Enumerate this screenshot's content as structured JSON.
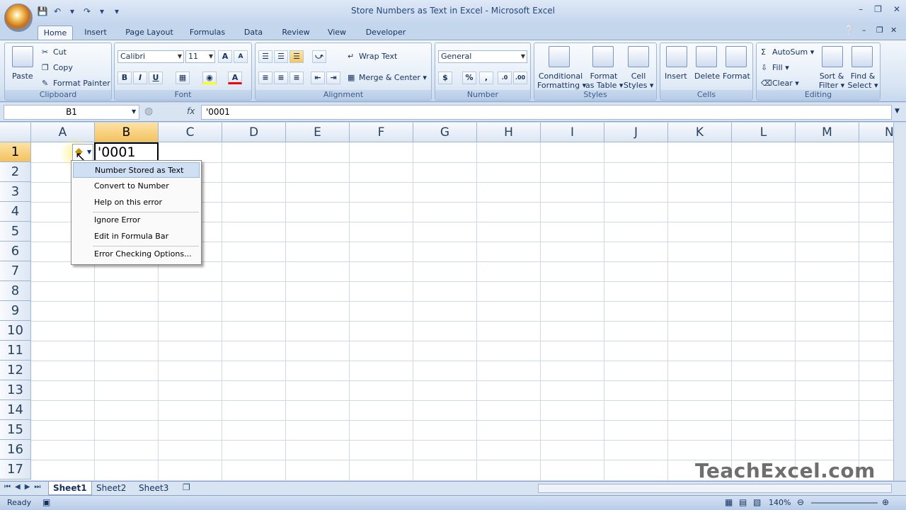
{
  "window": {
    "title": "Store Numbers as Text in Excel - Microsoft Excel"
  },
  "tabs": [
    "Home",
    "Insert",
    "Page Layout",
    "Formulas",
    "Data",
    "Review",
    "View",
    "Developer"
  ],
  "ribbon": {
    "clipboard": {
      "label": "Clipboard",
      "paste": "Paste",
      "cut": "Cut",
      "copy": "Copy",
      "format_painter": "Format Painter"
    },
    "font": {
      "label": "Font",
      "font_name": "Calibri",
      "font_size": "11"
    },
    "alignment": {
      "label": "Alignment",
      "wrap": "Wrap Text",
      "merge": "Merge & Center"
    },
    "number": {
      "label": "Number",
      "format": "General"
    },
    "styles": {
      "label": "Styles",
      "cond_line1": "Conditional",
      "cond_line2": "Formatting",
      "table_line1": "Format",
      "table_line2": "as Table",
      "cell_line1": "Cell",
      "cell_line2": "Styles"
    },
    "cells": {
      "label": "Cells",
      "insert": "Insert",
      "delete": "Delete",
      "format": "Format"
    },
    "editing": {
      "label": "Editing",
      "autosum": "AutoSum",
      "fill": "Fill",
      "clear": "Clear",
      "sort_line1": "Sort &",
      "sort_line2": "Filter",
      "find_line1": "Find &",
      "find_line2": "Select"
    }
  },
  "formula_bar": {
    "name_box": "B1",
    "fx": "fx",
    "content": "'0001"
  },
  "columns": [
    "A",
    "B",
    "C",
    "D",
    "E",
    "F",
    "G",
    "H",
    "I",
    "J",
    "K",
    "L",
    "M",
    "N"
  ],
  "rows": [
    "1",
    "2",
    "3",
    "4",
    "5",
    "6",
    "7",
    "8",
    "9",
    "10",
    "11",
    "12",
    "13",
    "14",
    "15",
    "16",
    "17"
  ],
  "cell_b1": "'0001",
  "context_menu": {
    "header": "Number Stored as Text",
    "items": [
      "Convert to Number",
      "Help on this error",
      "Ignore Error",
      "Edit in Formula Bar",
      "Error Checking Options..."
    ]
  },
  "sheets": [
    "Sheet1",
    "Sheet2",
    "Sheet3"
  ],
  "status": {
    "ready": "Ready",
    "zoom": "140%"
  },
  "watermark": "TeachExcel.com"
}
